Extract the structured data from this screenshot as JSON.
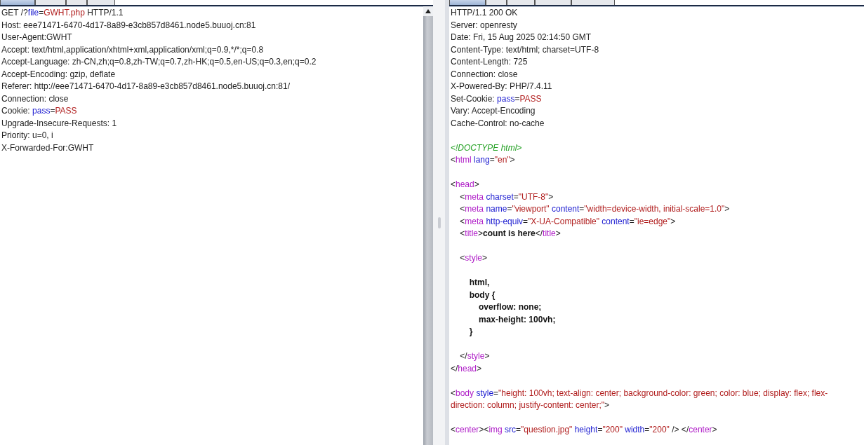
{
  "request": {
    "tabs": [
      {
        "selected": true
      },
      {
        "selected": false
      },
      {
        "selected": false
      },
      {
        "selected": false
      }
    ],
    "lines": [
      {
        "gap": false,
        "parts": [
          {
            "kind": "plain",
            "text": "GET /?"
          },
          {
            "kind": "name",
            "text": "file"
          },
          {
            "kind": "plain",
            "text": "="
          },
          {
            "kind": "value",
            "text": "GWHT.php"
          },
          {
            "kind": "plain",
            "text": " HTTP/1.1"
          }
        ]
      },
      {
        "gap": false,
        "parts": [
          {
            "kind": "plain",
            "text": "Host: eee71471-6470-4d17-8a89-e3cb857d8461.node5.buuoj.cn:81"
          }
        ]
      },
      {
        "gap": false,
        "parts": [
          {
            "kind": "plain",
            "text": "User-Agent:GWHT"
          }
        ]
      },
      {
        "gap": false,
        "parts": [
          {
            "kind": "plain",
            "text": "Accept: text/html,application/xhtml+xml,application/xml;q=0.9,*/*;q=0.8"
          }
        ]
      },
      {
        "gap": false,
        "parts": [
          {
            "kind": "plain",
            "text": "Accept-Language: zh-CN,zh;q=0.8,zh-TW;q=0.7,zh-HK;q=0.5,en-US;q=0.3,en;q=0.2"
          }
        ]
      },
      {
        "gap": false,
        "parts": [
          {
            "kind": "plain",
            "text": "Accept-Encoding: gzip, deflate"
          }
        ]
      },
      {
        "gap": false,
        "parts": [
          {
            "kind": "plain",
            "text": "Referer: http://eee71471-6470-4d17-8a89-e3cb857d8461.node5.buuoj.cn:81/"
          }
        ]
      },
      {
        "gap": false,
        "parts": [
          {
            "kind": "plain",
            "text": "Connection: close"
          }
        ]
      },
      {
        "gap": false,
        "parts": [
          {
            "kind": "plain",
            "text": "Cookie: "
          },
          {
            "kind": "name",
            "text": "pass"
          },
          {
            "kind": "plain",
            "text": "="
          },
          {
            "kind": "value",
            "text": "PASS"
          }
        ]
      },
      {
        "gap": false,
        "parts": [
          {
            "kind": "plain",
            "text": "Upgrade-Insecure-Requests: 1"
          }
        ]
      },
      {
        "gap": false,
        "parts": [
          {
            "kind": "plain",
            "text": "Priority: u=0, i"
          }
        ]
      },
      {
        "gap": false,
        "parts": [
          {
            "kind": "plain",
            "text": "X-Forwarded-For:GWHT"
          }
        ]
      }
    ]
  },
  "response": {
    "tabs": [
      {
        "selected": true
      },
      {
        "selected": false
      },
      {
        "selected": false
      },
      {
        "selected": false
      },
      {
        "selected": false
      }
    ],
    "lines": [
      {
        "gap": false,
        "parts": [
          {
            "kind": "plain",
            "text": "HTTP/1.1 200 OK"
          }
        ]
      },
      {
        "gap": false,
        "parts": [
          {
            "kind": "plain",
            "text": "Server: openresty"
          }
        ]
      },
      {
        "gap": false,
        "parts": [
          {
            "kind": "plain",
            "text": "Date: Fri, 15 Aug 2025 02:14:50 GMT"
          }
        ]
      },
      {
        "gap": false,
        "parts": [
          {
            "kind": "plain",
            "text": "Content-Type: text/html; charset=UTF-8"
          }
        ]
      },
      {
        "gap": false,
        "parts": [
          {
            "kind": "plain",
            "text": "Content-Length: 725"
          }
        ]
      },
      {
        "gap": false,
        "parts": [
          {
            "kind": "plain",
            "text": "Connection: close"
          }
        ]
      },
      {
        "gap": false,
        "parts": [
          {
            "kind": "plain",
            "text": "X-Powered-By: PHP/7.4.11"
          }
        ]
      },
      {
        "gap": false,
        "parts": [
          {
            "kind": "plain",
            "text": "Set-Cookie: "
          },
          {
            "kind": "name",
            "text": "pass"
          },
          {
            "kind": "plain",
            "text": "="
          },
          {
            "kind": "value",
            "text": "PASS"
          }
        ]
      },
      {
        "gap": false,
        "parts": [
          {
            "kind": "plain",
            "text": "Vary: Accept-Encoding"
          }
        ]
      },
      {
        "gap": false,
        "parts": [
          {
            "kind": "plain",
            "text": "Cache-Control: no-cache"
          }
        ]
      },
      {
        "gap": true,
        "parts": [
          {
            "kind": "comment",
            "text": "<!DOCTYPE html>"
          }
        ]
      },
      {
        "gap": false,
        "parts": [
          {
            "kind": "plain",
            "text": "<"
          },
          {
            "kind": "tag",
            "text": "html"
          },
          {
            "kind": "name",
            "text": " lang"
          },
          {
            "kind": "plain",
            "text": "="
          },
          {
            "kind": "value",
            "text": "\"en\""
          },
          {
            "kind": "plain",
            "text": ">"
          }
        ]
      },
      {
        "gap": true,
        "parts": [
          {
            "kind": "plain",
            "text": "<"
          },
          {
            "kind": "tag",
            "text": "head"
          },
          {
            "kind": "plain",
            "text": ">"
          }
        ]
      },
      {
        "gap": false,
        "parts": [
          {
            "kind": "plain",
            "text": "    <"
          },
          {
            "kind": "tag",
            "text": "meta"
          },
          {
            "kind": "name",
            "text": " charset"
          },
          {
            "kind": "plain",
            "text": "="
          },
          {
            "kind": "value",
            "text": "\"UTF-8\""
          },
          {
            "kind": "plain",
            "text": ">"
          }
        ]
      },
      {
        "gap": false,
        "parts": [
          {
            "kind": "plain",
            "text": "    <"
          },
          {
            "kind": "tag",
            "text": "meta"
          },
          {
            "kind": "name",
            "text": " name"
          },
          {
            "kind": "plain",
            "text": "="
          },
          {
            "kind": "value",
            "text": "\"viewport\""
          },
          {
            "kind": "name",
            "text": " content"
          },
          {
            "kind": "plain",
            "text": "="
          },
          {
            "kind": "value",
            "text": "\"width=device-width, initial-scale=1.0\""
          },
          {
            "kind": "plain",
            "text": ">"
          }
        ]
      },
      {
        "gap": false,
        "parts": [
          {
            "kind": "plain",
            "text": "    <"
          },
          {
            "kind": "tag",
            "text": "meta"
          },
          {
            "kind": "name",
            "text": " http-equiv"
          },
          {
            "kind": "plain",
            "text": "="
          },
          {
            "kind": "value",
            "text": "\"X-UA-Compatible\""
          },
          {
            "kind": "name",
            "text": " content"
          },
          {
            "kind": "plain",
            "text": "="
          },
          {
            "kind": "value",
            "text": "\"ie=edge\""
          },
          {
            "kind": "plain",
            "text": ">"
          }
        ]
      },
      {
        "gap": false,
        "parts": [
          {
            "kind": "plain",
            "text": "    <"
          },
          {
            "kind": "tag",
            "text": "title"
          },
          {
            "kind": "plain",
            "text": ">"
          },
          {
            "kind": "bold",
            "text": "count is here"
          },
          {
            "kind": "plain",
            "text": "</"
          },
          {
            "kind": "tag",
            "text": "title"
          },
          {
            "kind": "plain",
            "text": ">"
          }
        ]
      },
      {
        "gap": true,
        "parts": [
          {
            "kind": "plain",
            "text": "    <"
          },
          {
            "kind": "tag",
            "text": "style"
          },
          {
            "kind": "plain",
            "text": ">"
          }
        ]
      },
      {
        "gap": true,
        "parts": [
          {
            "kind": "bold",
            "text": "        html,"
          }
        ]
      },
      {
        "gap": false,
        "parts": [
          {
            "kind": "bold",
            "text": "        body {"
          }
        ]
      },
      {
        "gap": false,
        "parts": [
          {
            "kind": "bold",
            "text": "            overflow: none;"
          }
        ]
      },
      {
        "gap": false,
        "parts": [
          {
            "kind": "bold",
            "text": "            max-height: 100vh;"
          }
        ]
      },
      {
        "gap": false,
        "parts": [
          {
            "kind": "bold",
            "text": "        }"
          }
        ]
      },
      {
        "gap": true,
        "parts": [
          {
            "kind": "plain",
            "text": "    </"
          },
          {
            "kind": "tag",
            "text": "style"
          },
          {
            "kind": "plain",
            "text": ">"
          }
        ]
      },
      {
        "gap": false,
        "parts": [
          {
            "kind": "plain",
            "text": "</"
          },
          {
            "kind": "tag",
            "text": "head"
          },
          {
            "kind": "plain",
            "text": ">"
          }
        ]
      },
      {
        "gap": true,
        "parts": [
          {
            "kind": "plain",
            "text": "<"
          },
          {
            "kind": "tag",
            "text": "body"
          },
          {
            "kind": "name",
            "text": " style"
          },
          {
            "kind": "plain",
            "text": "="
          },
          {
            "kind": "value",
            "text": "\"height: 100vh; text-align: center; background-color: green; color: blue; display: flex; flex-direction: column; justify-content: center;\""
          },
          {
            "kind": "plain",
            "text": ">"
          }
        ]
      },
      {
        "gap": true,
        "parts": [
          {
            "kind": "plain",
            "text": "<"
          },
          {
            "kind": "tag",
            "text": "center"
          },
          {
            "kind": "plain",
            "text": "><"
          },
          {
            "kind": "tag",
            "text": "img"
          },
          {
            "kind": "name",
            "text": " src"
          },
          {
            "kind": "plain",
            "text": "="
          },
          {
            "kind": "value",
            "text": "\"question.jpg\""
          },
          {
            "kind": "name",
            "text": " height"
          },
          {
            "kind": "plain",
            "text": "="
          },
          {
            "kind": "value",
            "text": "\"200\""
          },
          {
            "kind": "name",
            "text": " width"
          },
          {
            "kind": "plain",
            "text": "="
          },
          {
            "kind": "value",
            "text": "\"200\""
          },
          {
            "kind": "plain",
            "text": " /> </"
          },
          {
            "kind": "tag",
            "text": "center"
          },
          {
            "kind": "plain",
            "text": ">"
          }
        ]
      }
    ]
  }
}
